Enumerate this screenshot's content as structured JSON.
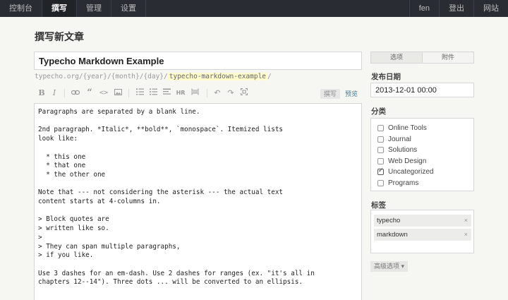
{
  "nav": {
    "left": [
      "控制台",
      "撰写",
      "管理",
      "设置"
    ],
    "right": [
      "fen",
      "登出",
      "网站"
    ]
  },
  "page_title": "撰写新文章",
  "post": {
    "title": "Typecho Markdown Example",
    "permalink_prefix": "typecho.org/{year}/{month}/{day}/",
    "slug": "typecho-markdown-example",
    "permalink_suffix": "/"
  },
  "toolbar": {
    "icons": [
      "bold-icon",
      "italic-icon",
      "link-icon",
      "quote-icon",
      "code-icon",
      "image-icon",
      "ordered-list-icon",
      "unordered-list-icon",
      "heading-icon",
      "horizontal-rule-icon",
      "more-icon",
      "undo-icon",
      "redo-icon",
      "fullscreen-icon"
    ],
    "write_tab": "撰写",
    "preview_tab": "预览"
  },
  "editor": {
    "lines": [
      "Paragraphs are separated by a blank line.",
      "",
      "2nd paragraph. *Italic*, **bold**, `monospace`. Itemized lists",
      "look like:",
      "",
      "  * this one",
      "  * that one",
      "  * the other one",
      "",
      "Note that --- not considering the asterisk --- the actual text",
      "content starts at 4-columns in.",
      "",
      "> Block quotes are",
      "> written like so.",
      ">",
      "> They can span multiple paragraphs,",
      "> if you like.",
      "",
      "Use 3 dashes for an em-dash. Use 2 dashes for ranges (ex. \"it's all in",
      "chapters 12--14\"). Three dots ... will be converted to an ellipsis."
    ]
  },
  "sidebar": {
    "tabs": [
      "选项",
      "附件"
    ],
    "publish_date_label": "发布日期",
    "publish_date": "2013-12-01 00:00",
    "category_label": "分类",
    "categories": [
      {
        "label": "Online Tools",
        "checked": false
      },
      {
        "label": "Journal",
        "checked": false
      },
      {
        "label": "Solutions",
        "checked": false
      },
      {
        "label": "Web Design",
        "checked": false
      },
      {
        "label": "Uncategorized",
        "checked": true
      },
      {
        "label": "Programs",
        "checked": false
      }
    ],
    "tags_label": "标签",
    "tags": [
      "typecho",
      "markdown"
    ],
    "tag_remove": "×",
    "advanced_button": "高级选项 ▾"
  }
}
